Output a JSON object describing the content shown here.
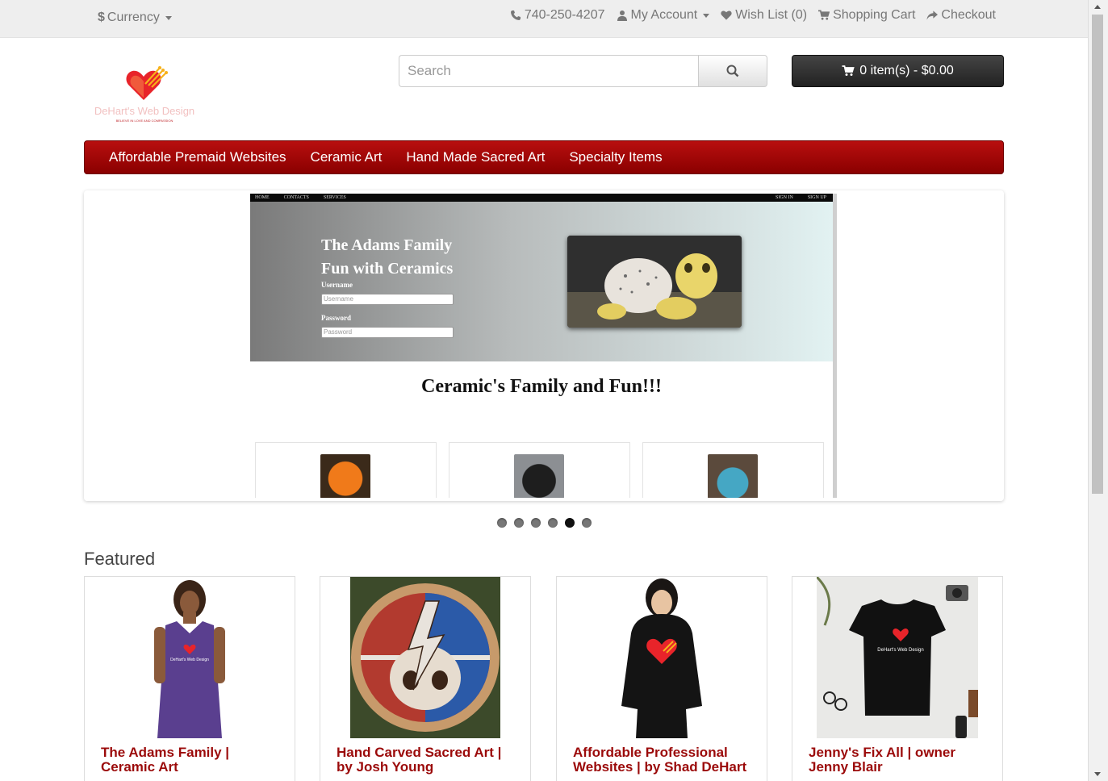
{
  "topbar": {
    "currency_symbol": "$",
    "currency_label": "Currency",
    "phone": "740-250-4207",
    "my_account": "My Account",
    "wish_list": "Wish List (0)",
    "shopping_cart": "Shopping Cart",
    "checkout": "Checkout"
  },
  "header": {
    "search_placeholder": "Search",
    "cart_button": "0 item(s) - $0.00"
  },
  "logo": {
    "text": "DeHart's Web Design",
    "tagline": "BELIEVE IN LOVE AND COMPASSION"
  },
  "menu": {
    "items": [
      {
        "label": "Affordable Premaid Websites"
      },
      {
        "label": "Ceramic Art"
      },
      {
        "label": "Hand Made Sacred Art"
      },
      {
        "label": "Specialty Items"
      }
    ]
  },
  "slide": {
    "nav_left": [
      "HOME",
      "CONTACTS",
      "SERVICES"
    ],
    "nav_right": [
      "SIGN IN",
      "SIGN UP"
    ],
    "title_line1": "The Adams Family",
    "title_line2": "Fun with Ceramics",
    "username_label": "Username",
    "username_placeholder": "Username",
    "password_label": "Password",
    "password_placeholder": "Password",
    "heading": "Ceramic's Family and Fun!!!"
  },
  "slideshow": {
    "dot_count": 6,
    "active_dot": 5
  },
  "featured": {
    "title": "Featured",
    "products": [
      {
        "line1": "The Adams Family |",
        "line2": "Ceramic Art"
      },
      {
        "line1": "Hand Carved Sacred Art |",
        "line2": "by Josh Young"
      },
      {
        "line1": "Affordable Professional",
        "line2": "Websites | by Shad DeHart"
      },
      {
        "line1": "Jenny's Fix All | owner",
        "line2": "Jenny Blair"
      }
    ]
  },
  "colors": {
    "menu_red": "#a30a0a",
    "product_title": "#9b0a0a",
    "cart_dark": "#333333"
  }
}
